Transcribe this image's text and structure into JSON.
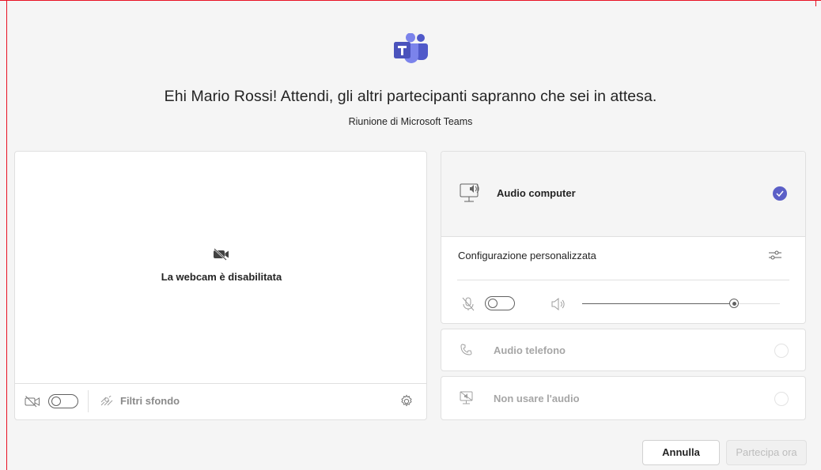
{
  "header": {
    "title": "Ehi Mario Rossi! Attendi, gli altri partecipanti sapranno che sei in attesa.",
    "subtitle": "Riunione di Microsoft Teams",
    "logo_icon": "microsoft-teams-logo"
  },
  "video_panel": {
    "status_label": "La webcam è disabilitata",
    "camera_toggle_state": "off",
    "background_filters_label": "Filtri sfondo"
  },
  "audio_options": {
    "computer": {
      "label": "Audio computer",
      "selected": true
    },
    "custom_setup": {
      "label": "Configurazione personalizzata",
      "mic_toggle_state": "off",
      "volume_fraction": 0.78
    },
    "phone": {
      "label": "Audio telefono",
      "selected": false
    },
    "none": {
      "label": "Non usare l'audio",
      "selected": false
    }
  },
  "actions": {
    "cancel_label": "Annulla",
    "join_label": "Partecipa ora"
  },
  "colors": {
    "accent": "#5b5fc7",
    "frame": "#e81123",
    "disabled_text": "#bdbdbd"
  }
}
